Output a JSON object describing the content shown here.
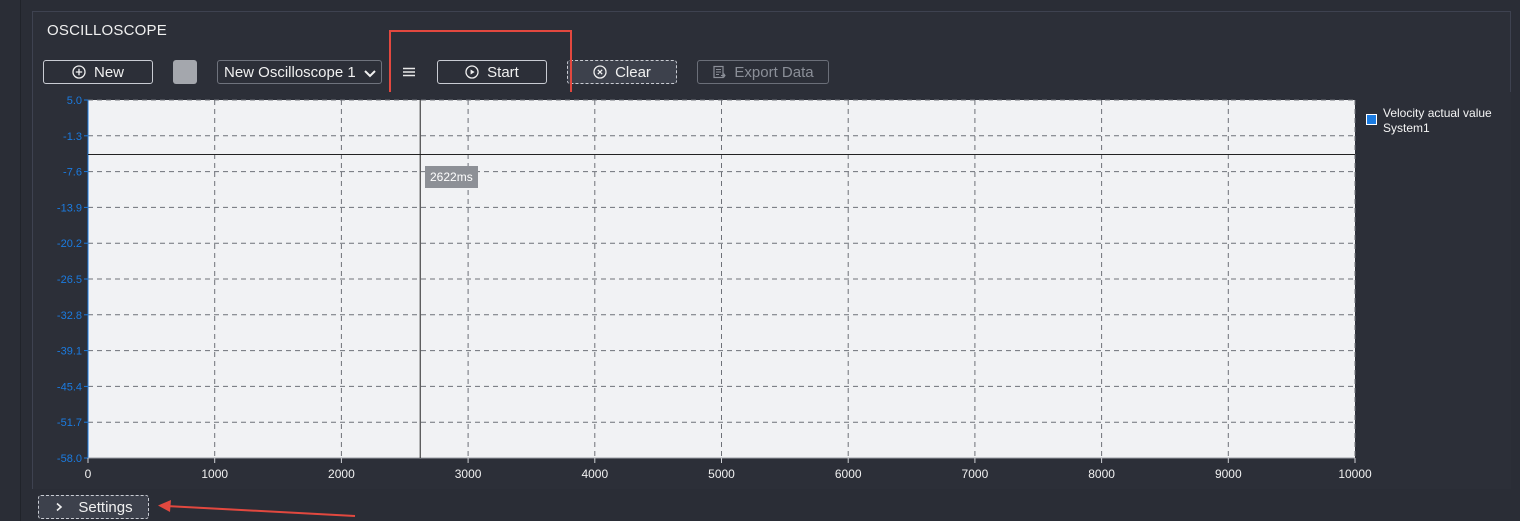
{
  "panel": {
    "title": "OSCILLOSCOPE"
  },
  "toolbar": {
    "new_label": "New",
    "oscilloscope_select": "New Oscilloscope 1",
    "start_label": "Start",
    "clear_label": "Clear",
    "export_label": "Export Data"
  },
  "colors": {
    "background": "#2a2d36",
    "plot_background": "#f1f2f4",
    "accent_blue": "#1b7be0",
    "highlight_red": "#e2483f",
    "swatch_gray": "#a4a7ad"
  },
  "icons": {
    "new": "plus-circle-icon",
    "start": "play-circle-icon",
    "clear": "x-circle-icon",
    "export": "export-icon",
    "menu": "hamburger-menu-icon",
    "settings": "chevron-right-icon"
  },
  "chart_data": {
    "type": "line",
    "title": "",
    "xlabel": "",
    "ylabel": "",
    "xlim": [
      0,
      10000
    ],
    "ylim": [
      -58.0,
      5.0
    ],
    "x_ticks": [
      "0",
      "1000",
      "2000",
      "3000",
      "4000",
      "5000",
      "6000",
      "7000",
      "8000",
      "9000",
      "10000"
    ],
    "y_ticks": [
      "5.0",
      "-1.3",
      "-7.6",
      "-13.9",
      "-20.2",
      "-26.5",
      "-32.8",
      "-39.1",
      "-45.4",
      "-51.7",
      "-58.0"
    ],
    "grid": true,
    "legend_position": "right",
    "series": [
      {
        "name": "Velocity actual value System1",
        "color": "#1b7be0",
        "x": [],
        "values": []
      }
    ],
    "cursor": {
      "x": 2622,
      "y": -4.6,
      "label": "2622ms"
    }
  },
  "legend": {
    "line1": "Velocity actual value",
    "line2": "System1"
  },
  "footer": {
    "settings_label": "Settings"
  }
}
